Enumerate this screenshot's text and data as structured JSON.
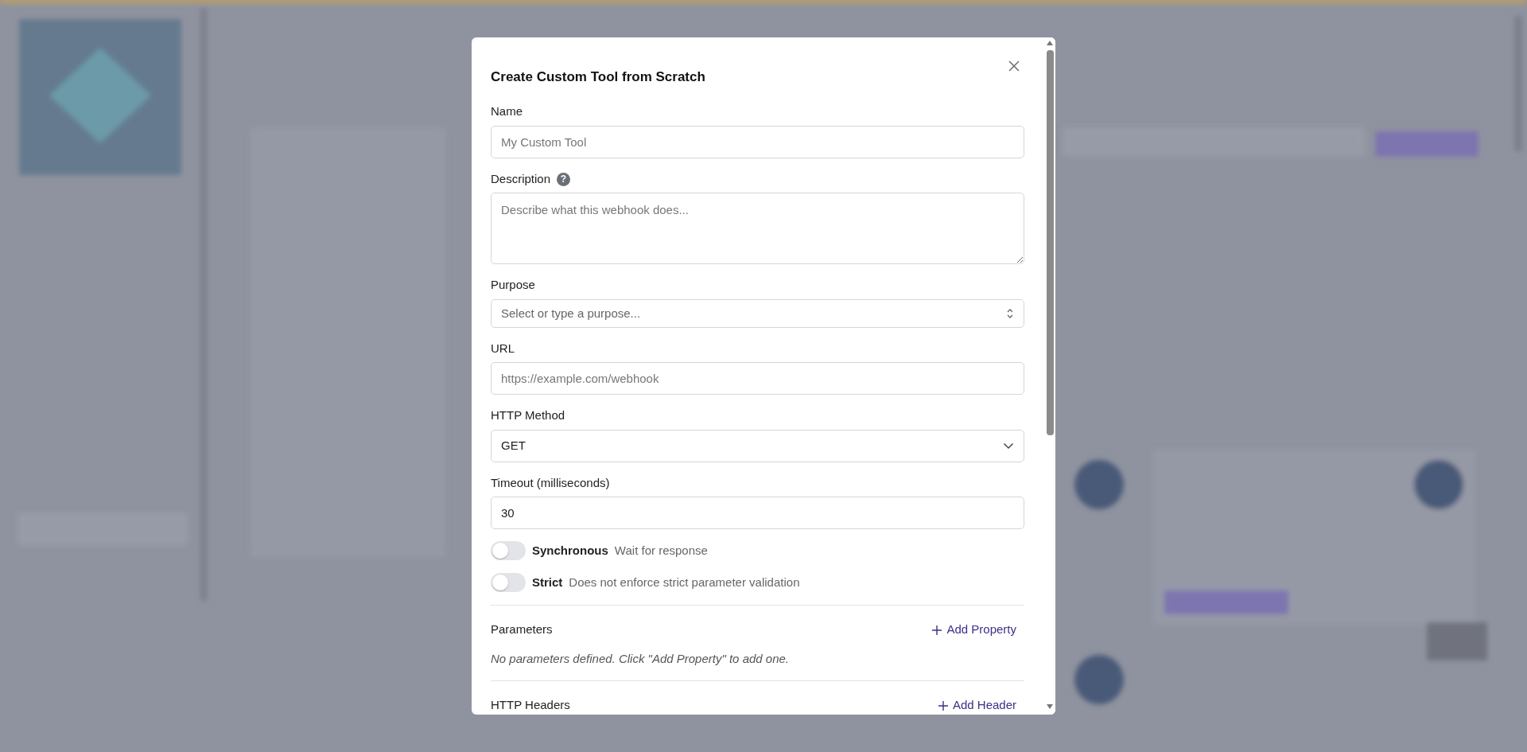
{
  "dialog": {
    "title": "Create Custom Tool from Scratch",
    "fields": [
      {
        "kind": "text",
        "label": "Name",
        "placeholder": "My Custom Tool"
      },
      {
        "kind": "textarea",
        "label": "Description",
        "help": "?",
        "placeholder": "Describe what this webhook does..."
      },
      {
        "kind": "combobox",
        "label": "Purpose",
        "placeholder": "Select or type a purpose..."
      },
      {
        "kind": "text",
        "label": "URL",
        "placeholder": "https://example.com/webhook"
      },
      {
        "kind": "select",
        "label": "HTTP Method",
        "value": "GET"
      },
      {
        "kind": "text",
        "label": "Timeout (milliseconds)",
        "value": "30"
      }
    ],
    "toggles": [
      {
        "label": "Synchronous",
        "hint": "Wait for response",
        "on": false
      },
      {
        "label": "Strict",
        "hint": "Does not enforce strict parameter validation",
        "on": false
      }
    ],
    "sections": [
      {
        "title": "Parameters",
        "action": "Add Property",
        "empty_text": "No parameters defined. Click \"Add Property\" to add one."
      },
      {
        "title": "HTTP Headers",
        "action": "Add Header"
      }
    ]
  }
}
